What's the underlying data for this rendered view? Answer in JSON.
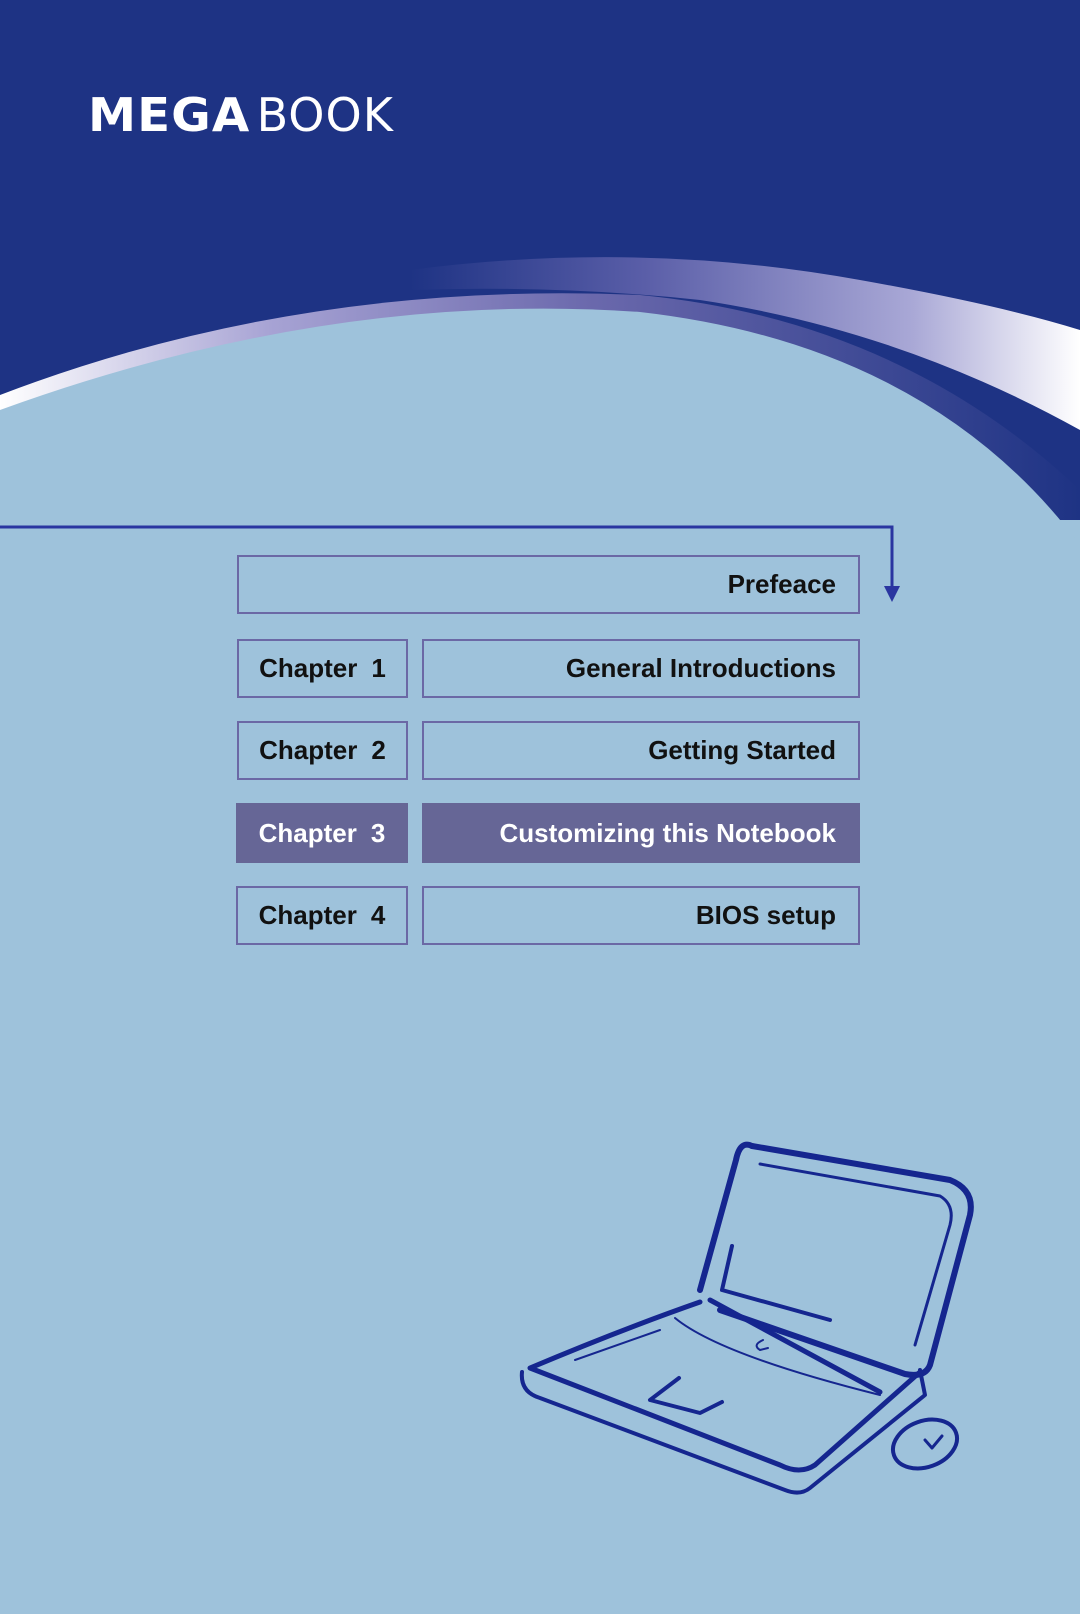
{
  "brand": {
    "logo_bold": "MEGA",
    "logo_light": "BOOK"
  },
  "colors": {
    "header_blue": "#1e3384",
    "page_bg": "#9ec2db",
    "accent_purple": "#666696",
    "line_blue": "#2a35a0",
    "sketch_blue": "#15268f"
  },
  "toc": {
    "preface": {
      "label": "Prefeace"
    },
    "chapters": [
      {
        "chapter_word": "Chapter",
        "number": "1",
        "title": "General Introductions",
        "active": false
      },
      {
        "chapter_word": "Chapter",
        "number": "2",
        "title": "Getting Started",
        "active": false
      },
      {
        "chapter_word": "Chapter",
        "number": "3",
        "title": "Customizing this Notebook",
        "active": true
      },
      {
        "chapter_word": "Chapter",
        "number": "4",
        "title": "BIOS setup",
        "active": false
      }
    ]
  },
  "illustration": {
    "icon": "laptop-with-mouse-sketch"
  }
}
